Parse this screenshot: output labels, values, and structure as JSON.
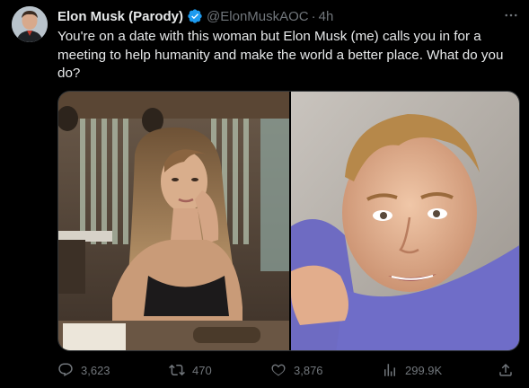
{
  "author": {
    "display_name": "Elon Musk (Parody)",
    "handle": "@ElonMuskAOC",
    "separator": "·",
    "timestamp": "4h",
    "verified_color": "#1d9bf0"
  },
  "tweet": {
    "text": "You're on a date with this woman but Elon Musk (me) calls you in for a meeting to help humanity and make the world a better place. What do you do?"
  },
  "media": {
    "left_image": "photo-woman-at-restaurant",
    "right_image": "photo-young-man-closeup"
  },
  "actions": {
    "reply_count": "3,623",
    "retweet_count": "470",
    "like_count": "3,876",
    "view_count": "299.9K"
  },
  "icons": {
    "more": "more-icon",
    "reply": "reply-icon",
    "retweet": "retweet-icon",
    "like": "heart-icon",
    "views": "views-icon",
    "share": "share-icon",
    "verified": "verified-badge-icon"
  },
  "colors": {
    "background": "#000000",
    "text_primary": "#e7e9ea",
    "text_secondary": "#71767b",
    "accent": "#1d9bf0"
  }
}
